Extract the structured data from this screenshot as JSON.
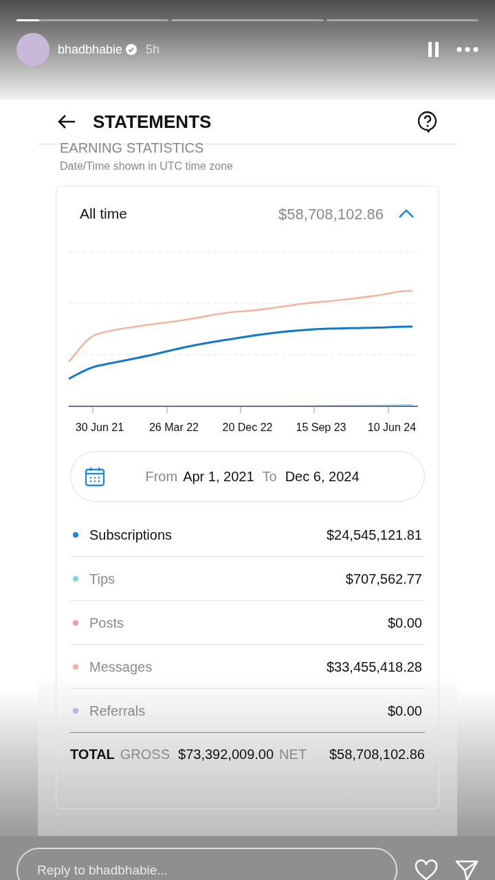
{
  "story": {
    "progress": [
      {
        "level": 0.15
      },
      {
        "level": 0
      },
      {
        "level": 0
      }
    ],
    "username": "bhadbhabie",
    "verified": true,
    "time": "5h",
    "paused": true
  },
  "app": {
    "title": "STATEMENTS",
    "section_title": "EARNING STATISTICS",
    "section_note": "Date/Time shown in UTC time zone"
  },
  "summary": {
    "period": "All time",
    "amount": "$58,708,102.86",
    "expanded": true
  },
  "chart": {
    "x_labels": [
      "30 Jun 21",
      "26 Mar 22",
      "20 Dec 22",
      "15 Sep 23",
      "10 Jun 24"
    ]
  },
  "date_range": {
    "from_label": "From",
    "from": "Apr 1, 2021",
    "to_label": "To",
    "to": "Dec 6, 2024"
  },
  "rows": [
    {
      "label": "Subscriptions",
      "amount": "$24,545,121.81",
      "color": "#1a8ad4",
      "selected": true
    },
    {
      "label": "Tips",
      "amount": "$707,562.77",
      "color": "#7fd6dc",
      "selected": false
    },
    {
      "label": "Posts",
      "amount": "$0.00",
      "color": "#e89aae",
      "selected": false
    },
    {
      "label": "Messages",
      "amount": "$33,455,418.28",
      "color": "#f0b49c",
      "selected": false
    },
    {
      "label": "Referrals",
      "amount": "$0.00",
      "color": "#b9b3dd",
      "selected": false
    }
  ],
  "total": {
    "label": "TOTAL",
    "gross_label": "GROSS",
    "gross": "$73,392,009.00",
    "net_label": "NET",
    "net": "$58,708,102.86"
  },
  "reply": {
    "placeholder": "Reply to bhadbhabie..."
  }
}
